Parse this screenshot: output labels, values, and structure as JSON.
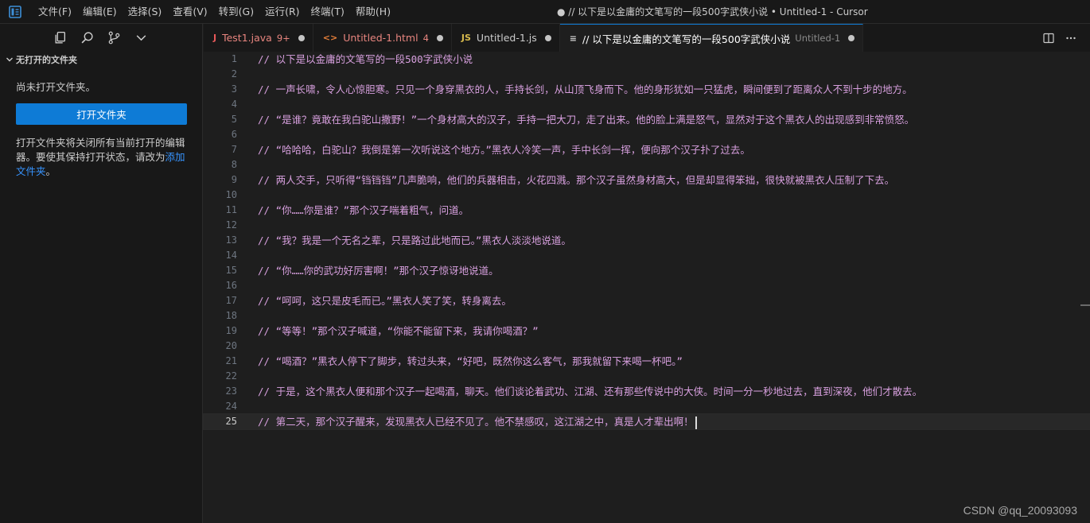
{
  "window": {
    "title": "● // 以下是以金庸的文笔写的一段500字武侠小说 • Untitled-1 - Cursor",
    "menu": [
      "文件(F)",
      "编辑(E)",
      "选择(S)",
      "查看(V)",
      "转到(G)",
      "运行(R)",
      "终端(T)",
      "帮助(H)"
    ]
  },
  "sidebar": {
    "section_title": "无打开的文件夹",
    "empty_message": "尚未打开文件夹。",
    "open_button": "打开文件夹",
    "hint_text": "打开文件夹将关闭所有当前打开的编辑器。要使其保持打开状态，请改为",
    "hint_link": "添加文件夹",
    "hint_end": "。"
  },
  "tabs": [
    {
      "icon": "J",
      "icon_color": "#e8595a",
      "label": "Test1.java",
      "badge": "9+",
      "label_color": "#e8857f",
      "desc": ""
    },
    {
      "icon": "<>",
      "icon_color": "#e8803a",
      "label": "Untitled-1.html",
      "badge": "4",
      "label_color": "#e8857f",
      "desc": ""
    },
    {
      "icon": "JS",
      "icon_color": "#d7ba4c",
      "label": "Untitled-1.js",
      "badge": "",
      "label_color": "#cccccc",
      "desc": ""
    },
    {
      "icon": "≡",
      "icon_color": "#cccccc",
      "label": "// 以下是以金庸的文笔写的一段500字武侠小说",
      "badge": "",
      "label_color": "#ffffff",
      "desc": "Untitled-1"
    }
  ],
  "editor": {
    "current_line": 25,
    "lines": [
      {
        "n": "1",
        "text": "// 以下是以金庸的文笔写的一段500字武侠小说"
      },
      {
        "n": "2",
        "text": ""
      },
      {
        "n": "3",
        "text": "// 一声长啸，令人心惊胆寒。只见一个身穿黑衣的人，手持长剑，从山顶飞身而下。他的身形犹如一只猛虎，瞬间便到了距离众人不到十步的地方。"
      },
      {
        "n": "4",
        "text": ""
      },
      {
        "n": "5",
        "text": "// “是谁？竟敢在我白驼山撒野！”一个身材高大的汉子，手持一把大刀，走了出来。他的脸上满是怒气，显然对于这个黑衣人的出现感到非常愤怒。"
      },
      {
        "n": "6",
        "text": ""
      },
      {
        "n": "7",
        "text": "// “哈哈哈，白驼山？我倒是第一次听说这个地方。”黑衣人冷笑一声，手中长剑一挥，便向那个汉子扑了过去。"
      },
      {
        "n": "8",
        "text": ""
      },
      {
        "n": "9",
        "text": "// 两人交手，只听得“铛铛铛”几声脆响，他们的兵器相击，火花四溅。那个汉子虽然身材高大，但是却显得笨拙，很快就被黑衣人压制了下去。"
      },
      {
        "n": "10",
        "text": ""
      },
      {
        "n": "11",
        "text": "// “你……你是谁？”那个汉子喘着粗气，问道。"
      },
      {
        "n": "12",
        "text": ""
      },
      {
        "n": "13",
        "text": "// “我？我是一个无名之辈，只是路过此地而已。”黑衣人淡淡地说道。"
      },
      {
        "n": "14",
        "text": ""
      },
      {
        "n": "15",
        "text": "// “你……你的武功好厉害啊！”那个汉子惊讶地说道。"
      },
      {
        "n": "16",
        "text": ""
      },
      {
        "n": "17",
        "text": "// “呵呵，这只是皮毛而已。”黑衣人笑了笑，转身离去。"
      },
      {
        "n": "18",
        "text": ""
      },
      {
        "n": "19",
        "text": "// “等等！”那个汉子喊道，“你能不能留下来，我请你喝酒？”"
      },
      {
        "n": "20",
        "text": ""
      },
      {
        "n": "21",
        "text": "// “喝酒？”黑衣人停下了脚步，转过头来，“好吧，既然你这么客气，那我就留下来喝一杯吧。”"
      },
      {
        "n": "22",
        "text": ""
      },
      {
        "n": "23",
        "text": "// 于是，这个黑衣人便和那个汉子一起喝酒，聊天。他们谈论着武功、江湖、还有那些传说中的大侠。时间一分一秒地过去，直到深夜，他们才散去。"
      },
      {
        "n": "24",
        "text": ""
      },
      {
        "n": "25",
        "text": "// 第二天，那个汉子醒来，发现黑衣人已经不见了。他不禁感叹，这江湖之中，真是人才辈出啊！"
      }
    ]
  },
  "watermark": "CSDN @qq_20093093",
  "colors": {
    "accent": "#0e7bd6",
    "comment": "#d8a0df",
    "link": "#3794ff"
  }
}
